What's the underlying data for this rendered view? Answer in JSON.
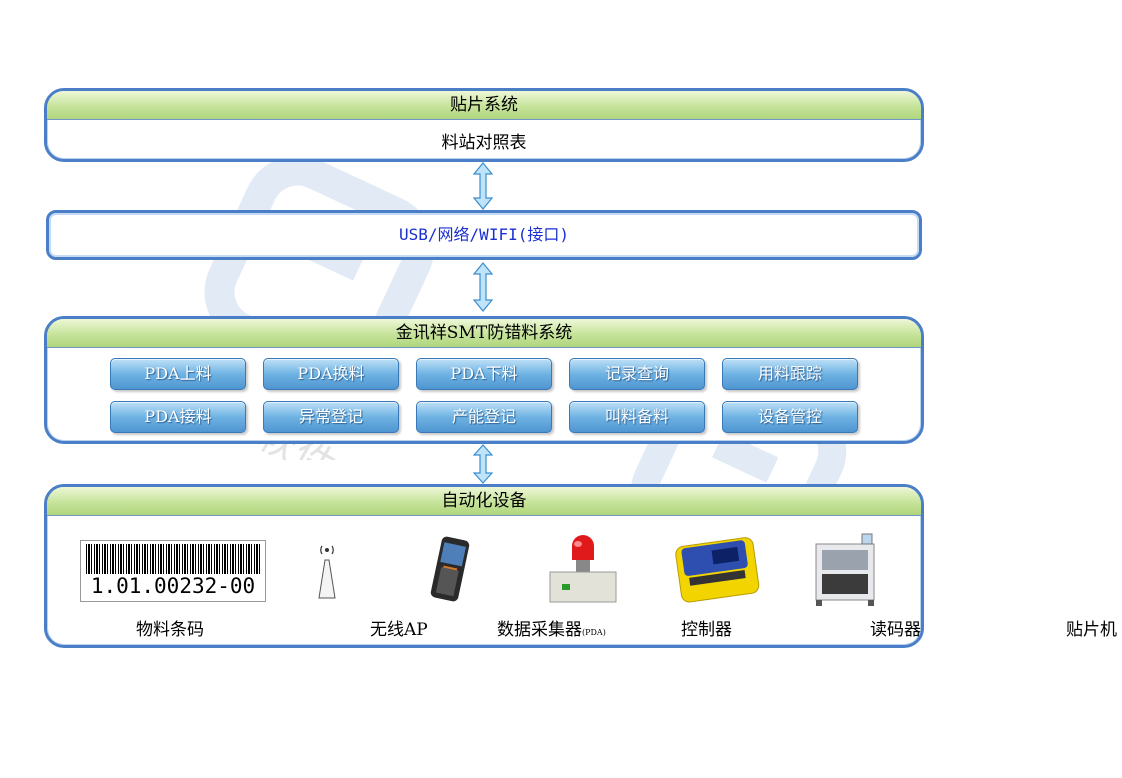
{
  "top_panel": {
    "title": "贴片系统",
    "subtitle": "料站对照表"
  },
  "interface": {
    "label": "USB/网络/WIFI(接口)"
  },
  "system_panel": {
    "title": "金讯祥SMT防错料系统",
    "modules": [
      "PDA上料",
      "PDA换料",
      "PDA下料",
      "记录查询",
      "用料跟踪",
      "PDA接料",
      "异常登记",
      "产能登记",
      "叫料备料",
      "设备管控"
    ]
  },
  "device_panel": {
    "title": "自动化设备",
    "barcode_text": "1.01.00232-00",
    "labels": {
      "material_barcode": "物料条码",
      "wireless_ap": "无线AP",
      "data_collector": "数据采集器",
      "data_collector_suffix": "(PDA)",
      "controller": "控制器",
      "reader": "读码器",
      "placement_machine": "贴片机"
    }
  },
  "watermark": {
    "text": "象趣软件"
  },
  "colors": {
    "panel_border": "#4a7fc8",
    "header_green": "#c6e39a",
    "module_blue": "#6fb3e3",
    "interface_text": "#1a2fd0"
  }
}
